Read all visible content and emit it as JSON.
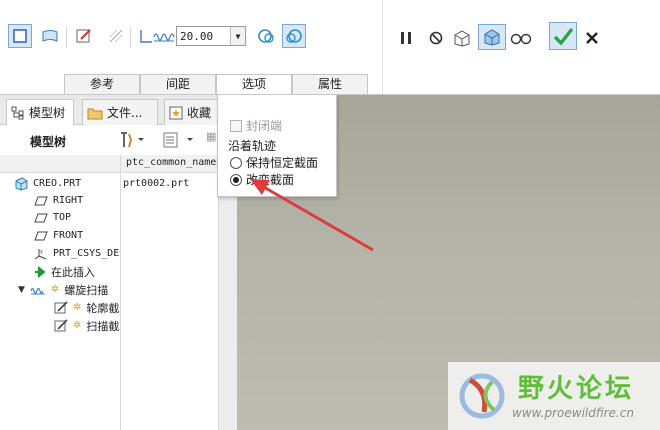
{
  "ribbon": {
    "depth_value": "20.00",
    "tabs": [
      {
        "label": "参考"
      },
      {
        "label": "间距"
      },
      {
        "label": "选项"
      },
      {
        "label": "属性"
      }
    ],
    "active_tab": "选项",
    "icons": [
      "solid-icon",
      "surface-icon",
      "sketch-icon",
      "remove-material-icon",
      "thicken-icon",
      "helix-pitch-icon",
      "right-hand-icon",
      "left-hand-icon",
      "pause-icon",
      "no-preview-icon",
      "preview-geometry-icon",
      "verify-mode-icon",
      "glasses-preview-icon",
      "confirm-icon",
      "cancel-icon"
    ],
    "accent_color": "#2aa44a"
  },
  "left_panel": {
    "tabs": [
      {
        "label": "模型树"
      },
      {
        "label": "文件..."
      },
      {
        "label": "收藏"
      }
    ],
    "tree_title": "模型树",
    "columns": [
      "ptc_common_name"
    ],
    "rows": [
      {
        "label": "CREO.PRT",
        "value": "prt0002.prt"
      },
      {
        "label": "RIGHT",
        "value": ""
      },
      {
        "label": "TOP",
        "value": ""
      },
      {
        "label": "FRONT",
        "value": ""
      },
      {
        "label": "PRT_CSYS_DE",
        "value": ""
      },
      {
        "label": "在此插入",
        "value": ""
      },
      {
        "label": "螺旋扫描",
        "value": ""
      },
      {
        "label": "轮廓截",
        "value": ""
      },
      {
        "label": "扫描截",
        "value": ""
      }
    ]
  },
  "options_panel": {
    "capped_ends_label": "封闭端",
    "capped_ends_checked": false,
    "section_title": "沿着轨迹",
    "radio_options": [
      {
        "label": "保持恒定截面",
        "selected": false
      },
      {
        "label": "改变截面",
        "selected": true
      }
    ]
  },
  "watermark": {
    "title": "野火论坛",
    "url": "www.proewildfire.cn"
  },
  "colors": {
    "graphics_bg": "#b2b2a6",
    "annotation_arrow": "#e23a3a",
    "watermark_green": "#5fbf3a"
  }
}
